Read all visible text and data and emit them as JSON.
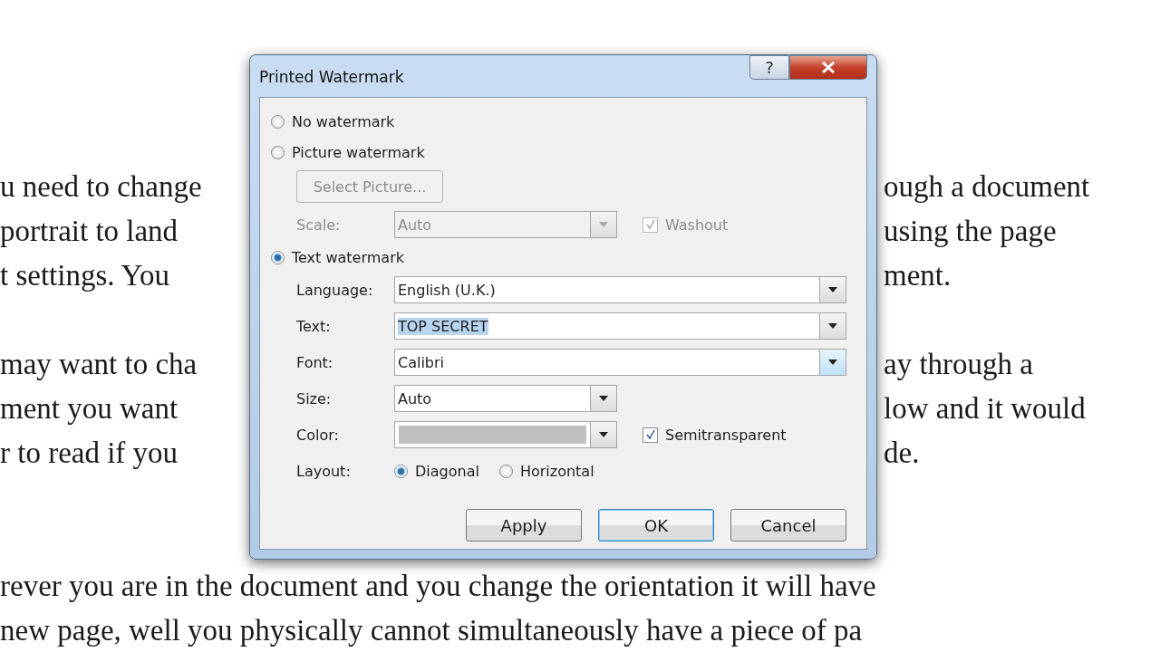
{
  "document": {
    "paragraphs": [
      {
        "lines": [
          {
            "left": "u need to change",
            "right": "ough a document"
          },
          {
            "left": "portrait to land",
            "right": "using the page"
          },
          {
            "left": "t settings. You",
            "right": "ment."
          }
        ]
      },
      {
        "lines": [
          {
            "left": "may want to cha",
            "right": "ay through a"
          },
          {
            "left": "ment you want",
            "right": "low and it would"
          },
          {
            "left": "r to read if you",
            "right": "de."
          }
        ]
      },
      {
        "lines": [
          {
            "left": "rever you are in the document and you change the orientation it will have"
          },
          {
            "left": "new page, well you physically cannot simultaneously have a piece of pa"
          }
        ]
      }
    ]
  },
  "dialog": {
    "title": "Printed Watermark",
    "help": "?",
    "options": [
      {
        "label": "No watermark",
        "selected": false
      },
      {
        "label": "Picture watermark",
        "selected": false
      },
      {
        "label": "Text watermark",
        "selected": true
      }
    ],
    "picture_settings": {
      "disabled": true,
      "select_button": "Select Picture...",
      "scale_label": "Scale:",
      "scale_value": "Auto",
      "washout": {
        "label": "Washout",
        "checked": true
      }
    },
    "text_settings": {
      "fields": [
        {
          "label": "Language:",
          "kind": "wide",
          "value": "English (U.K.)",
          "highlighted": false
        },
        {
          "label": "Text:",
          "kind": "wide",
          "value": "TOP SECRET",
          "highlighted": true
        },
        {
          "label": "Font:",
          "kind": "wide",
          "value": "Calibri",
          "highlighted": false,
          "hovered": true
        },
        {
          "label": "Size:",
          "kind": "short",
          "value": "Auto",
          "highlighted": false
        },
        {
          "label": "Color:",
          "kind": "color",
          "color": "#c0c0c0"
        }
      ],
      "semitransparent": {
        "label": "Semitransparent",
        "checked": true
      },
      "layout_label": "Layout:",
      "layouts": [
        {
          "label": "Diagonal",
          "selected": true
        },
        {
          "label": "Horizontal",
          "selected": false
        }
      ]
    },
    "buttons": [
      {
        "label": "Apply",
        "default": false
      },
      {
        "label": "OK",
        "default": true
      },
      {
        "label": "Cancel",
        "default": false
      }
    ]
  }
}
